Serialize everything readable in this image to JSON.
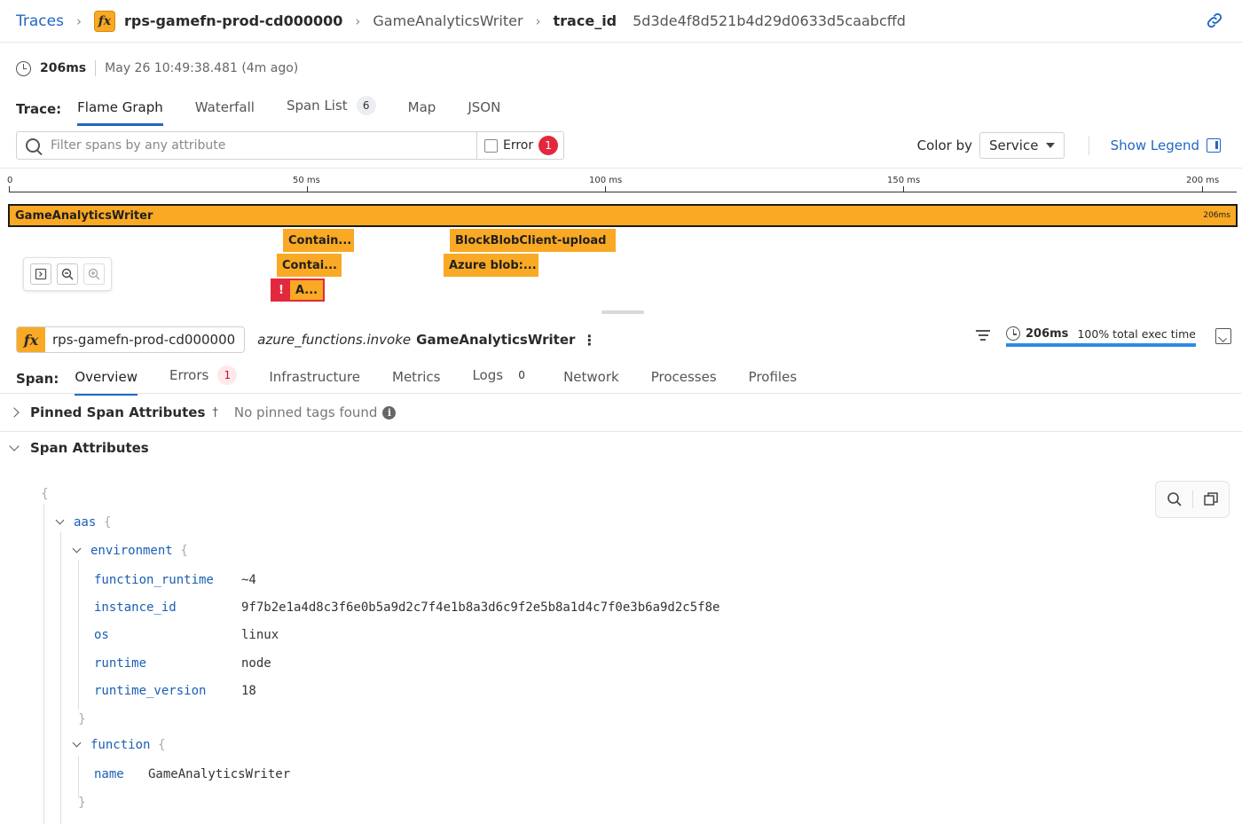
{
  "breadcrumb": {
    "root": "Traces",
    "service_icon": "fx-function-icon",
    "service": "rps-gamefn-prod-cd000000",
    "resource": "GameAnalyticsWriter",
    "trace_label": "trace_id",
    "trace_id": "5d3de4f8d521b4d29d0633d5caabcffd"
  },
  "meta": {
    "duration": "206ms",
    "timestamp": "May 26 10:49:38.481 (4m ago)"
  },
  "trace_tabs": {
    "label": "Trace:",
    "items": [
      {
        "label": "Flame Graph",
        "active": true
      },
      {
        "label": "Waterfall"
      },
      {
        "label": "Span List",
        "count": "6"
      },
      {
        "label": "Map"
      },
      {
        "label": "JSON"
      }
    ]
  },
  "filter": {
    "placeholder": "Filter spans by any attribute",
    "error_label": "Error",
    "error_count": "1",
    "color_by_label": "Color by",
    "color_by_value": "Service",
    "legend_label": "Show Legend"
  },
  "flame": {
    "ticks": [
      "0",
      "50 ms",
      "100 ms",
      "150 ms",
      "200 ms"
    ],
    "spans": [
      {
        "label": "GameAnalyticsWriter",
        "duration": "206ms"
      },
      {
        "label": "Contain..."
      },
      {
        "label": "BlockBlobClient-upload"
      },
      {
        "label": "Contai..."
      },
      {
        "label": "Azure blob:..."
      },
      {
        "label": "A...",
        "error": true
      }
    ],
    "colors": {
      "span": "#f9a923",
      "error": "#e3283e"
    }
  },
  "span_header": {
    "service": "rps-gamefn-prod-cd000000",
    "operation": "azure_functions.invoke",
    "resource": "GameAnalyticsWriter",
    "duration": "206ms",
    "exec_pct_text": "100% total exec time",
    "exec_fraction": 1.0
  },
  "span_tabs": {
    "label": "Span:",
    "items": [
      {
        "label": "Overview",
        "active": true
      },
      {
        "label": "Errors",
        "count": "1"
      },
      {
        "label": "Infrastructure"
      },
      {
        "label": "Metrics"
      },
      {
        "label": "Logs",
        "count": "0"
      },
      {
        "label": "Network"
      },
      {
        "label": "Processes"
      },
      {
        "label": "Profiles"
      }
    ]
  },
  "pinned": {
    "title": "Pinned Span Attributes",
    "empty": "No pinned tags found"
  },
  "attributes": {
    "title": "Span Attributes",
    "open_brace": "{",
    "close_brace": "}",
    "aas_key": "aas",
    "environment_key": "environment",
    "env": [
      {
        "key": "function_runtime",
        "value": "~4"
      },
      {
        "key": "instance_id",
        "value": "9f7b2e1a4d8c3f6e0b5a9d2c7f4e1b8a3d6c9f2e5b8a1d4c7f0e3b6a9d2c5f8e"
      },
      {
        "key": "os",
        "value": "linux"
      },
      {
        "key": "runtime",
        "value": "node"
      },
      {
        "key": "runtime_version",
        "value": "18"
      }
    ],
    "function_key": "function",
    "function_name_key": "name",
    "function_name_value": "GameAnalyticsWriter"
  }
}
